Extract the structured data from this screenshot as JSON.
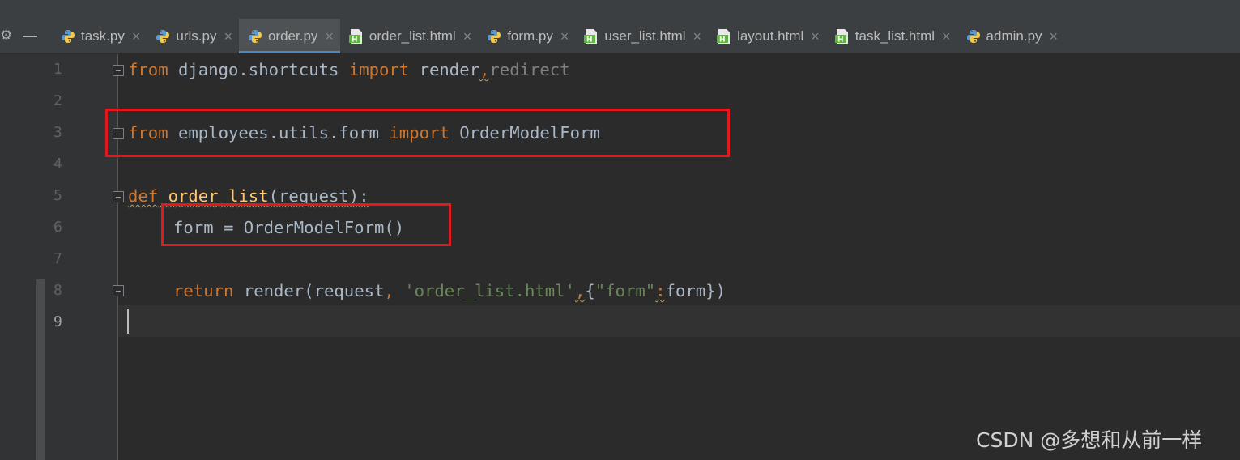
{
  "tabs": [
    {
      "label": "task.py",
      "icon": "python-file-icon",
      "active": false
    },
    {
      "label": "urls.py",
      "icon": "python-file-icon",
      "active": false
    },
    {
      "label": "order.py",
      "icon": "python-file-icon",
      "active": true
    },
    {
      "label": "order_list.html",
      "icon": "html-file-icon",
      "active": false
    },
    {
      "label": "form.py",
      "icon": "python-file-icon",
      "active": false
    },
    {
      "label": "user_list.html",
      "icon": "html-file-icon",
      "active": false
    },
    {
      "label": "layout.html",
      "icon": "html-file-icon",
      "active": false
    },
    {
      "label": "task_list.html",
      "icon": "html-file-icon",
      "active": false
    },
    {
      "label": "admin.py",
      "icon": "python-file-icon",
      "active": false
    }
  ],
  "tab_close_glyph": "×",
  "line_numbers": [
    "1",
    "2",
    "3",
    "4",
    "5",
    "6",
    "7",
    "8",
    "9"
  ],
  "current_line": "9",
  "code": {
    "line1": {
      "kw_from": "from",
      "module": " django.shortcuts ",
      "kw_import": "import",
      "name1": " render",
      "comma": ",",
      "name2": "redirect"
    },
    "line3": {
      "kw_from": "from",
      "module": " employees.utils.form ",
      "kw_import": "import",
      "name": " OrderModelForm"
    },
    "line5": {
      "kw_def": "def",
      "sp": " ",
      "fname": "order_list",
      "params": "(request):"
    },
    "line6": {
      "text": "form = OrderModelForm()"
    },
    "line8": {
      "kw_return": "return",
      "call_open": " render(request",
      "comma1": ",",
      "sp": " ",
      "str_tpl": "'order_list.html'",
      "comma2": ",",
      "brace_open": "{",
      "str_key": "\"form\"",
      "colon": ":",
      "value": "form",
      "close": "})"
    }
  },
  "watermark": "CSDN @多想和从前一样",
  "colors": {
    "editor_bg": "#2b2b2b",
    "keyword": "#cc7832",
    "function_name": "#ffc66d",
    "string": "#6a8759",
    "identifier": "#a9b7c6",
    "annotation_box": "#e0191f",
    "active_tab_underline": "#4a88c7"
  }
}
